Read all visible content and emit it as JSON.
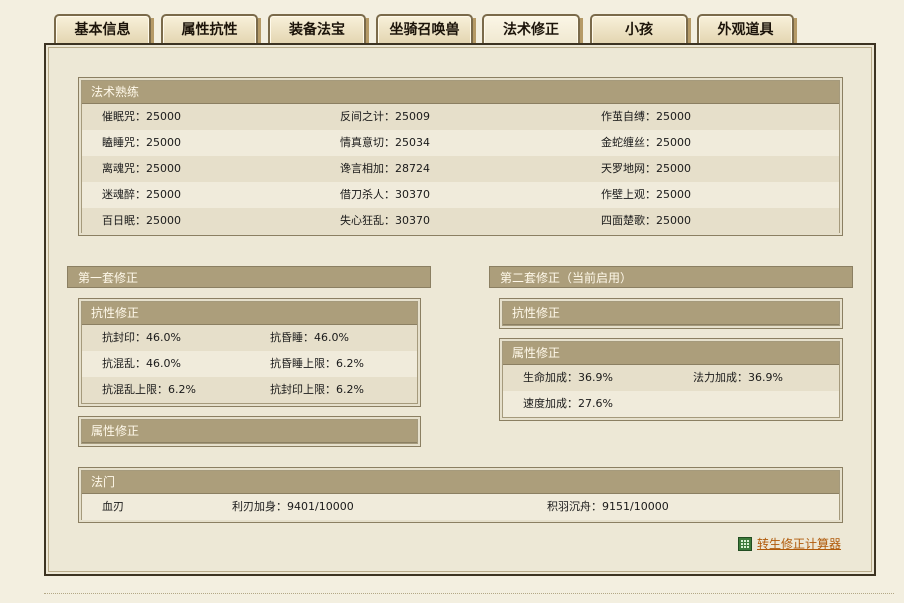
{
  "tabs": [
    "基本信息",
    "属性抗性",
    "装备法宝",
    "坐骑召唤兽",
    "法术修正",
    "小孩",
    "外观道具"
  ],
  "active_tab": "法术修正",
  "spell_mastery": {
    "title": "法术熟练",
    "rows": [
      [
        "催眠咒：25000",
        "反间之计：25009",
        "作茧自缚：25000"
      ],
      [
        "瞌睡咒：25000",
        "情真意切：25034",
        "金蛇缠丝：25000"
      ],
      [
        "离魂咒：25000",
        "谗言相加：28724",
        "天罗地网：25000"
      ],
      [
        "迷魂醉：25000",
        "借刀杀人：30370",
        "作壁上观：25000"
      ],
      [
        "百日眠：25000",
        "失心狂乱：30370",
        "四面楚歌：25000"
      ]
    ]
  },
  "set1": {
    "title": "第一套修正",
    "resist": {
      "title": "抗性修正",
      "rows": [
        [
          "抗封印：46.0%",
          "抗昏睡：46.0%"
        ],
        [
          "抗混乱：46.0%",
          "抗昏睡上限：6.2%"
        ],
        [
          "抗混乱上限：6.2%",
          "抗封印上限：6.2%"
        ]
      ]
    },
    "attr": {
      "title": "属性修正"
    }
  },
  "set2": {
    "title": "第二套修正（当前启用）",
    "resist": {
      "title": "抗性修正"
    },
    "attr": {
      "title": "属性修正",
      "rows": [
        [
          "生命加成：36.9%",
          "法力加成：36.9%"
        ],
        [
          "速度加成：27.6%"
        ]
      ]
    }
  },
  "dharma": {
    "title": "法门",
    "items": [
      "血刃",
      "利刃加身：9401/10000",
      "积羽沉舟：9151/10000"
    ]
  },
  "calculator_link": "转生修正计算器"
}
